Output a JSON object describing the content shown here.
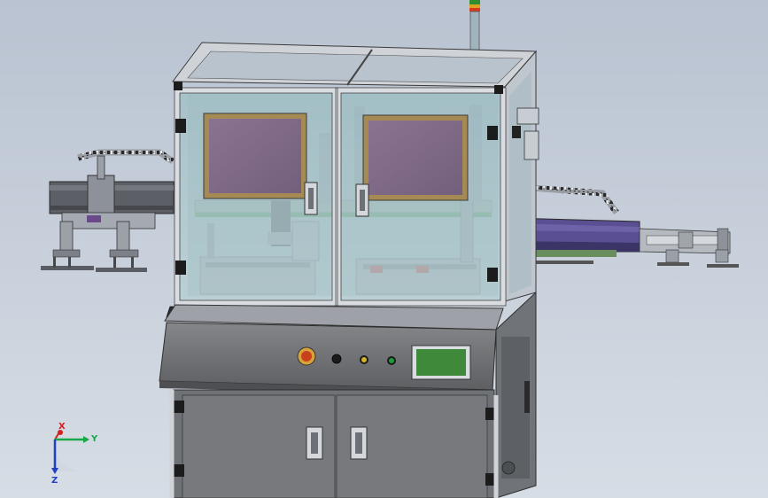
{
  "viewport": {
    "background_top": "#b9c3d1",
    "background_bottom": "#d7dde5"
  },
  "machine": {
    "frame_color": "#b4b9c0",
    "glass_color": "#a9c7cc",
    "panel_color": "#6f7073",
    "screen_color": "#7e6a86",
    "hmi_screen_color": "#3f8a3a",
    "conveyor_accent": "#4b3f86",
    "tower_light_colors": [
      "#2f8c2f",
      "#e0a020",
      "#d83a20"
    ],
    "control_buttons": [
      {
        "name": "emergency-stop",
        "color": "#c8401c"
      },
      {
        "name": "black-button",
        "color": "#1b1b1b"
      },
      {
        "name": "yellow-button",
        "color": "#d6b524"
      },
      {
        "name": "green-button",
        "color": "#1c9c3a"
      }
    ]
  },
  "triad": {
    "x_label": "X",
    "y_label": "Y",
    "z_label": "Z",
    "x_color": "#d62020",
    "y_color": "#18a848",
    "z_color": "#2040c0"
  }
}
